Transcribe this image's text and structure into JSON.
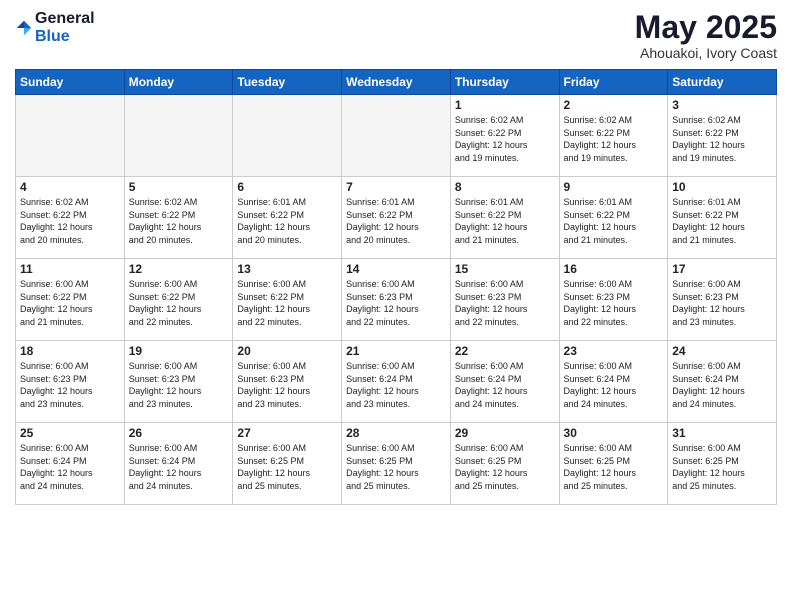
{
  "logo": {
    "general": "General",
    "blue": "Blue"
  },
  "title": "May 2025",
  "location": "Ahouakoi, Ivory Coast",
  "weekdays": [
    "Sunday",
    "Monday",
    "Tuesday",
    "Wednesday",
    "Thursday",
    "Friday",
    "Saturday"
  ],
  "weeks": [
    [
      {
        "day": "",
        "info": ""
      },
      {
        "day": "",
        "info": ""
      },
      {
        "day": "",
        "info": ""
      },
      {
        "day": "",
        "info": ""
      },
      {
        "day": "1",
        "info": "Sunrise: 6:02 AM\nSunset: 6:22 PM\nDaylight: 12 hours\nand 19 minutes."
      },
      {
        "day": "2",
        "info": "Sunrise: 6:02 AM\nSunset: 6:22 PM\nDaylight: 12 hours\nand 19 minutes."
      },
      {
        "day": "3",
        "info": "Sunrise: 6:02 AM\nSunset: 6:22 PM\nDaylight: 12 hours\nand 19 minutes."
      }
    ],
    [
      {
        "day": "4",
        "info": "Sunrise: 6:02 AM\nSunset: 6:22 PM\nDaylight: 12 hours\nand 20 minutes."
      },
      {
        "day": "5",
        "info": "Sunrise: 6:02 AM\nSunset: 6:22 PM\nDaylight: 12 hours\nand 20 minutes."
      },
      {
        "day": "6",
        "info": "Sunrise: 6:01 AM\nSunset: 6:22 PM\nDaylight: 12 hours\nand 20 minutes."
      },
      {
        "day": "7",
        "info": "Sunrise: 6:01 AM\nSunset: 6:22 PM\nDaylight: 12 hours\nand 20 minutes."
      },
      {
        "day": "8",
        "info": "Sunrise: 6:01 AM\nSunset: 6:22 PM\nDaylight: 12 hours\nand 21 minutes."
      },
      {
        "day": "9",
        "info": "Sunrise: 6:01 AM\nSunset: 6:22 PM\nDaylight: 12 hours\nand 21 minutes."
      },
      {
        "day": "10",
        "info": "Sunrise: 6:01 AM\nSunset: 6:22 PM\nDaylight: 12 hours\nand 21 minutes."
      }
    ],
    [
      {
        "day": "11",
        "info": "Sunrise: 6:00 AM\nSunset: 6:22 PM\nDaylight: 12 hours\nand 21 minutes."
      },
      {
        "day": "12",
        "info": "Sunrise: 6:00 AM\nSunset: 6:22 PM\nDaylight: 12 hours\nand 22 minutes."
      },
      {
        "day": "13",
        "info": "Sunrise: 6:00 AM\nSunset: 6:22 PM\nDaylight: 12 hours\nand 22 minutes."
      },
      {
        "day": "14",
        "info": "Sunrise: 6:00 AM\nSunset: 6:23 PM\nDaylight: 12 hours\nand 22 minutes."
      },
      {
        "day": "15",
        "info": "Sunrise: 6:00 AM\nSunset: 6:23 PM\nDaylight: 12 hours\nand 22 minutes."
      },
      {
        "day": "16",
        "info": "Sunrise: 6:00 AM\nSunset: 6:23 PM\nDaylight: 12 hours\nand 22 minutes."
      },
      {
        "day": "17",
        "info": "Sunrise: 6:00 AM\nSunset: 6:23 PM\nDaylight: 12 hours\nand 23 minutes."
      }
    ],
    [
      {
        "day": "18",
        "info": "Sunrise: 6:00 AM\nSunset: 6:23 PM\nDaylight: 12 hours\nand 23 minutes."
      },
      {
        "day": "19",
        "info": "Sunrise: 6:00 AM\nSunset: 6:23 PM\nDaylight: 12 hours\nand 23 minutes."
      },
      {
        "day": "20",
        "info": "Sunrise: 6:00 AM\nSunset: 6:23 PM\nDaylight: 12 hours\nand 23 minutes."
      },
      {
        "day": "21",
        "info": "Sunrise: 6:00 AM\nSunset: 6:24 PM\nDaylight: 12 hours\nand 23 minutes."
      },
      {
        "day": "22",
        "info": "Sunrise: 6:00 AM\nSunset: 6:24 PM\nDaylight: 12 hours\nand 24 minutes."
      },
      {
        "day": "23",
        "info": "Sunrise: 6:00 AM\nSunset: 6:24 PM\nDaylight: 12 hours\nand 24 minutes."
      },
      {
        "day": "24",
        "info": "Sunrise: 6:00 AM\nSunset: 6:24 PM\nDaylight: 12 hours\nand 24 minutes."
      }
    ],
    [
      {
        "day": "25",
        "info": "Sunrise: 6:00 AM\nSunset: 6:24 PM\nDaylight: 12 hours\nand 24 minutes."
      },
      {
        "day": "26",
        "info": "Sunrise: 6:00 AM\nSunset: 6:24 PM\nDaylight: 12 hours\nand 24 minutes."
      },
      {
        "day": "27",
        "info": "Sunrise: 6:00 AM\nSunset: 6:25 PM\nDaylight: 12 hours\nand 25 minutes."
      },
      {
        "day": "28",
        "info": "Sunrise: 6:00 AM\nSunset: 6:25 PM\nDaylight: 12 hours\nand 25 minutes."
      },
      {
        "day": "29",
        "info": "Sunrise: 6:00 AM\nSunset: 6:25 PM\nDaylight: 12 hours\nand 25 minutes."
      },
      {
        "day": "30",
        "info": "Sunrise: 6:00 AM\nSunset: 6:25 PM\nDaylight: 12 hours\nand 25 minutes."
      },
      {
        "day": "31",
        "info": "Sunrise: 6:00 AM\nSunset: 6:25 PM\nDaylight: 12 hours\nand 25 minutes."
      }
    ]
  ]
}
